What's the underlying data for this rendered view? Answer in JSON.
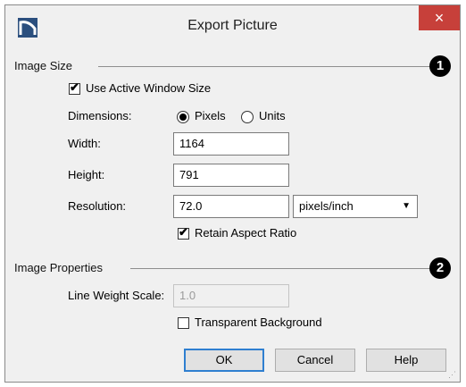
{
  "window": {
    "title": "Export Picture",
    "close_icon": "×"
  },
  "image_size": {
    "group_title": "Image Size",
    "callout": "1",
    "use_active_window_size": {
      "label": "Use Active Window Size",
      "checked": true
    },
    "dimensions": {
      "label": "Dimensions:",
      "options": [
        "Pixels",
        "Units"
      ],
      "selected": "Pixels"
    },
    "width": {
      "label": "Width:",
      "value": "1164"
    },
    "height": {
      "label": "Height:",
      "value": "791"
    },
    "resolution": {
      "label": "Resolution:",
      "value": "72.0",
      "unit": "pixels/inch"
    },
    "retain_aspect_ratio": {
      "label": "Retain Aspect Ratio",
      "checked": true
    }
  },
  "image_properties": {
    "group_title": "Image Properties",
    "callout": "2",
    "line_weight_scale": {
      "label": "Line Weight Scale:",
      "value": "1.0",
      "disabled": true
    },
    "transparent_background": {
      "label": "Transparent Background",
      "checked": false
    }
  },
  "buttons": {
    "ok": "OK",
    "cancel": "Cancel",
    "help": "Help"
  }
}
